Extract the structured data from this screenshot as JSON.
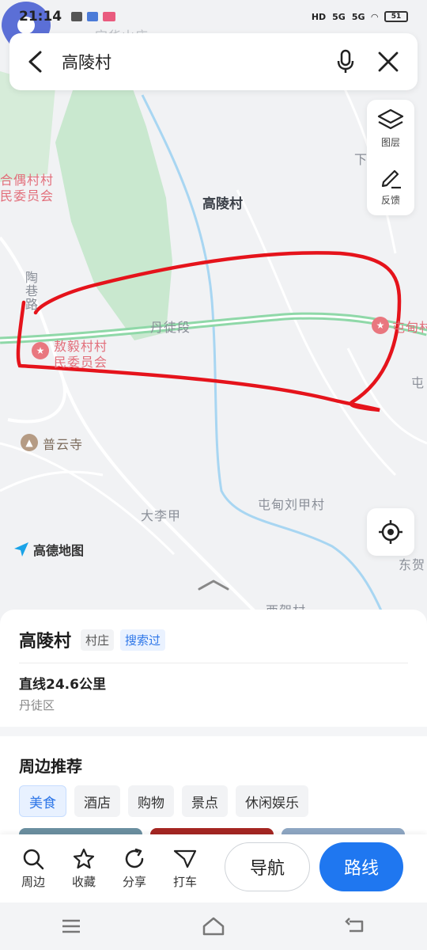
{
  "status": {
    "time": "21:14",
    "signal1": "5G",
    "signal2": "5G",
    "hd": "HD",
    "battery": "51"
  },
  "search": {
    "query": "高陵村"
  },
  "tools": [
    {
      "label": "图层"
    },
    {
      "label": "反馈"
    }
  ],
  "map": {
    "pin_label": "高陵村",
    "labels": {
      "top_faded": "宝华山庄",
      "village_committee_1": "合偶村村",
      "village_committee_1b": "民委员会",
      "road_tao": "陶巷路",
      "dantu": "丹徒段",
      "aoyi": "敖毅村村",
      "aoyi_b": "民委员会",
      "tundian_right": "屯甸村",
      "tun": "屯",
      "puyun": "普云寺",
      "dalijia": "大李甲",
      "tundian_liujia": "屯甸刘甲村",
      "donghe": "东贺",
      "xiahe": "西贺村",
      "xia": "下"
    },
    "logo": "高德地图"
  },
  "place": {
    "name": "高陵村",
    "tag_type": "村庄",
    "tag_history": "搜索过",
    "distance": "直线24.6公里",
    "district": "丹徒区"
  },
  "nearby": {
    "title": "周边推荐",
    "categories": [
      "美食",
      "酒店",
      "购物",
      "景点",
      "休闲娱乐"
    ]
  },
  "actions": {
    "items": [
      {
        "label": "周边",
        "icon": "search-icon"
      },
      {
        "label": "收藏",
        "icon": "star-icon"
      },
      {
        "label": "分享",
        "icon": "share-icon"
      },
      {
        "label": "打车",
        "icon": "taxi-icon"
      }
    ],
    "nav": "导航",
    "route": "路线"
  },
  "colors": {
    "accent": "#1f77f0",
    "highway": "#8fd8a8",
    "annotation": "#e5131b",
    "pin": "#5b6fd6"
  }
}
